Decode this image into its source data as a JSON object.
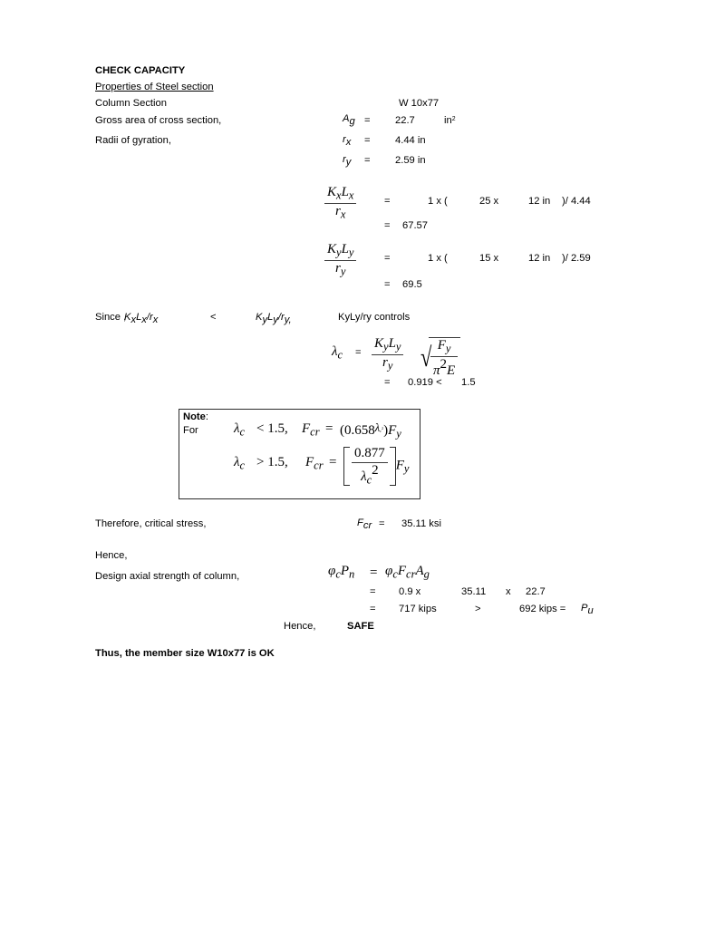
{
  "document": {
    "title": "CHECK CAPACITY",
    "section_heading": "Properties of Steel section",
    "properties": {
      "column_section_label": "Column Section",
      "column_section_value": "W  10x77",
      "gross_area_label": "Gross area of cross section,",
      "gross_area_symbol": "A",
      "gross_area_symbol_sub": "g",
      "eq": "=",
      "gross_area_value": "22.7",
      "gross_area_unit": "in",
      "gross_area_unit_exp": "2",
      "radii_label": "Radii of gyration,",
      "rx_symbol": "r",
      "rx_sub": "x",
      "rx_value": "4.44 in",
      "ry_symbol": "r",
      "ry_sub": "y",
      "ry_value": "2.59 in"
    },
    "slenderness_x": {
      "num_K": "K",
      "num_K_sub": "x",
      "num_L": "L",
      "num_L_sub": "x",
      "den_r": "r",
      "den_r_sub": "x",
      "eq": "=",
      "k_value": "1 x (",
      "length_value": "25 x",
      "factor_value": "12 in",
      "close_divide": ")/ 4.44",
      "result_eq": "=",
      "result": "67.57"
    },
    "slenderness_y": {
      "num_K": "K",
      "num_K_sub": "y",
      "num_L": "L",
      "num_L_sub": "y",
      "den_r": "r",
      "den_r_sub": "y",
      "eq": "=",
      "k_value": "1 x (",
      "length_value": "15 x",
      "factor_value": "12 in",
      "close_divide": ")/ 2.59",
      "result_eq": "=",
      "result": "69.5"
    },
    "comparison": {
      "since_label": "Since ,",
      "left_K": "K",
      "left_K_sub": "x",
      "left_L": "L",
      "left_L_sub": "x",
      "left_r": "/r",
      "left_r_sub": "x",
      "operator": "<",
      "right_K": "K",
      "right_K_sub": "y",
      "right_L": "L",
      "right_L_sub": "y",
      "right_r": "/r",
      "right_r_sub": "y,",
      "controls_text": "KyLy/ry controls"
    },
    "lambda_equation": {
      "lambda_symbol": "λ",
      "lambda_sub": "c",
      "eq": "=",
      "num_K": "K",
      "num_K_sub": "y",
      "num_L": "L",
      "num_L_sub": "y",
      "den_r": "r",
      "den_r_sub": "y",
      "radicand_num_F": "F",
      "radicand_num_F_sub": "y",
      "radicand_den_pi": "π",
      "radicand_den_pi_exp": "2",
      "radicand_den_E": "E",
      "result_eq": "=",
      "result_value": "0.919 <",
      "limit_value": "1.5"
    },
    "note_box": {
      "title": "Note",
      "title_colon": ":",
      "for_label": "For",
      "case1": {
        "lambda": "λ",
        "lambda_sub": "c",
        "condition": "< 1.5,",
        "Fcr": "F",
        "Fcr_sub": "cr",
        "eq": "=",
        "expr_open": "(0.658",
        "exp_lambda": "λ",
        "exp_lambda_sub": "c",
        "exp_power": "2",
        "expr_close": ")",
        "Fy": "F",
        "Fy_sub": "y"
      },
      "case2": {
        "lambda": "λ",
        "lambda_sub": "c",
        "condition": "> 1.5,",
        "Fcr": "F",
        "Fcr_sub": "cr",
        "eq": "=",
        "numerator": "0.877",
        "den_lambda": "λ",
        "den_lambda_sub": "c",
        "den_power": "2",
        "Fy": "F",
        "Fy_sub": "y"
      }
    },
    "critical_stress": {
      "label": "Therefore, critical stress,",
      "symbol": "F",
      "symbol_sub": "cr",
      "eq": "=",
      "value": "35.11 ksi"
    },
    "design_strength": {
      "hence_label": "Hence,",
      "label": "Design axial strength of column,",
      "phi": "φ",
      "phi_sub": "c",
      "P": "P",
      "P_sub": "n",
      "eq": "=",
      "rhs_phi": "φ",
      "rhs_phi_sub": "c",
      "rhs_F": "F",
      "rhs_F_sub": "cr",
      "rhs_A": "A",
      "rhs_A_sub": "g",
      "line2_eq": "=",
      "line2_phi_value": "0.9 x",
      "line2_fcr_value": "35.11",
      "line2_times": "x",
      "line2_ag_value": "22.7",
      "line3_eq": "=",
      "line3_capacity": "717 kips",
      "line3_operator": ">",
      "line3_demand": "692 kips  =",
      "line3_pu": "P",
      "line3_pu_sub": "u",
      "conclusion_hence": "Hence,",
      "conclusion_value": "SAFE"
    },
    "final_statement": "Thus, the member size W10x77 is OK"
  }
}
